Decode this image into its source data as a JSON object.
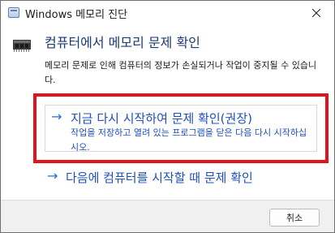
{
  "window": {
    "title": "Windows 메모리 진단"
  },
  "icons": {
    "title": "memory-chip-icon",
    "close": "close-icon",
    "memory": "memory-chip-icon"
  },
  "dialog": {
    "heading": "컴퓨터에서 메모리 문제 확인",
    "description": "메모리 문제로 인해 컴퓨터의 정보가 손실되거나 작업이 중지될 수 있습니다.",
    "options": [
      {
        "arrow": "→",
        "title": "지금 다시 시작하여 문제 확인(권장)",
        "subtitle": "작업을 저장하고 열려 있는 프로그램을 닫은 다음 다시 시작하십시오."
      },
      {
        "arrow": "→",
        "title": "다음에 컴퓨터를 시작할 때 문제 확인"
      }
    ]
  },
  "footer": {
    "cancel_label": "취소"
  },
  "colors": {
    "accent_blue": "#1f4fbf",
    "heading_blue": "#1c3a78",
    "highlight_red": "#e3121c"
  }
}
